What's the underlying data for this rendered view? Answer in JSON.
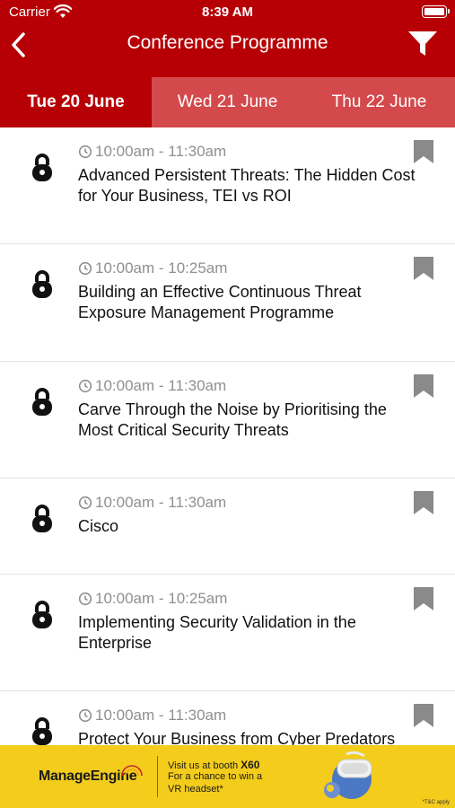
{
  "status_bar": {
    "carrier": "Carrier",
    "time": "8:39 AM"
  },
  "nav": {
    "title": "Conference Programme",
    "back_icon": "chevron-left-icon",
    "filter_icon": "filter-icon"
  },
  "tabs": [
    {
      "label": "Tue 20 June",
      "active": true
    },
    {
      "label": "Wed 21 June",
      "active": false
    },
    {
      "label": "Thu 22 June",
      "active": false
    }
  ],
  "sessions": [
    {
      "time": "10:00am - 11:30am",
      "title": "Advanced Persistent Threats: The Hidden Cost for Your Business, TEI vs ROI"
    },
    {
      "time": "10:00am - 10:25am",
      "title": "Building an Effective Continuous Threat Exposure Management Programme"
    },
    {
      "time": "10:00am - 11:30am",
      "title": "Carve Through the Noise by Prioritising the Most Critical Security Threats"
    },
    {
      "time": "10:00am - 11:30am",
      "title": "Cisco"
    },
    {
      "time": "10:00am - 10:25am",
      "title": "Implementing Security Validation in the Enterprise"
    },
    {
      "time": "10:00am - 11:30am",
      "title": "Protect Your Business from Cyber Predators"
    }
  ],
  "ad": {
    "brand": "ManageEngine",
    "line1_prefix": "Visit us at booth ",
    "booth": "X60",
    "line2": "For a chance to win a",
    "line3": "VR headset*",
    "tc": "*T&C apply"
  },
  "colors": {
    "primary": "#b60005",
    "tab_inactive": "#d4494c",
    "ad_background": "#f3cc1c",
    "bookmark": "#8a8a8a"
  }
}
